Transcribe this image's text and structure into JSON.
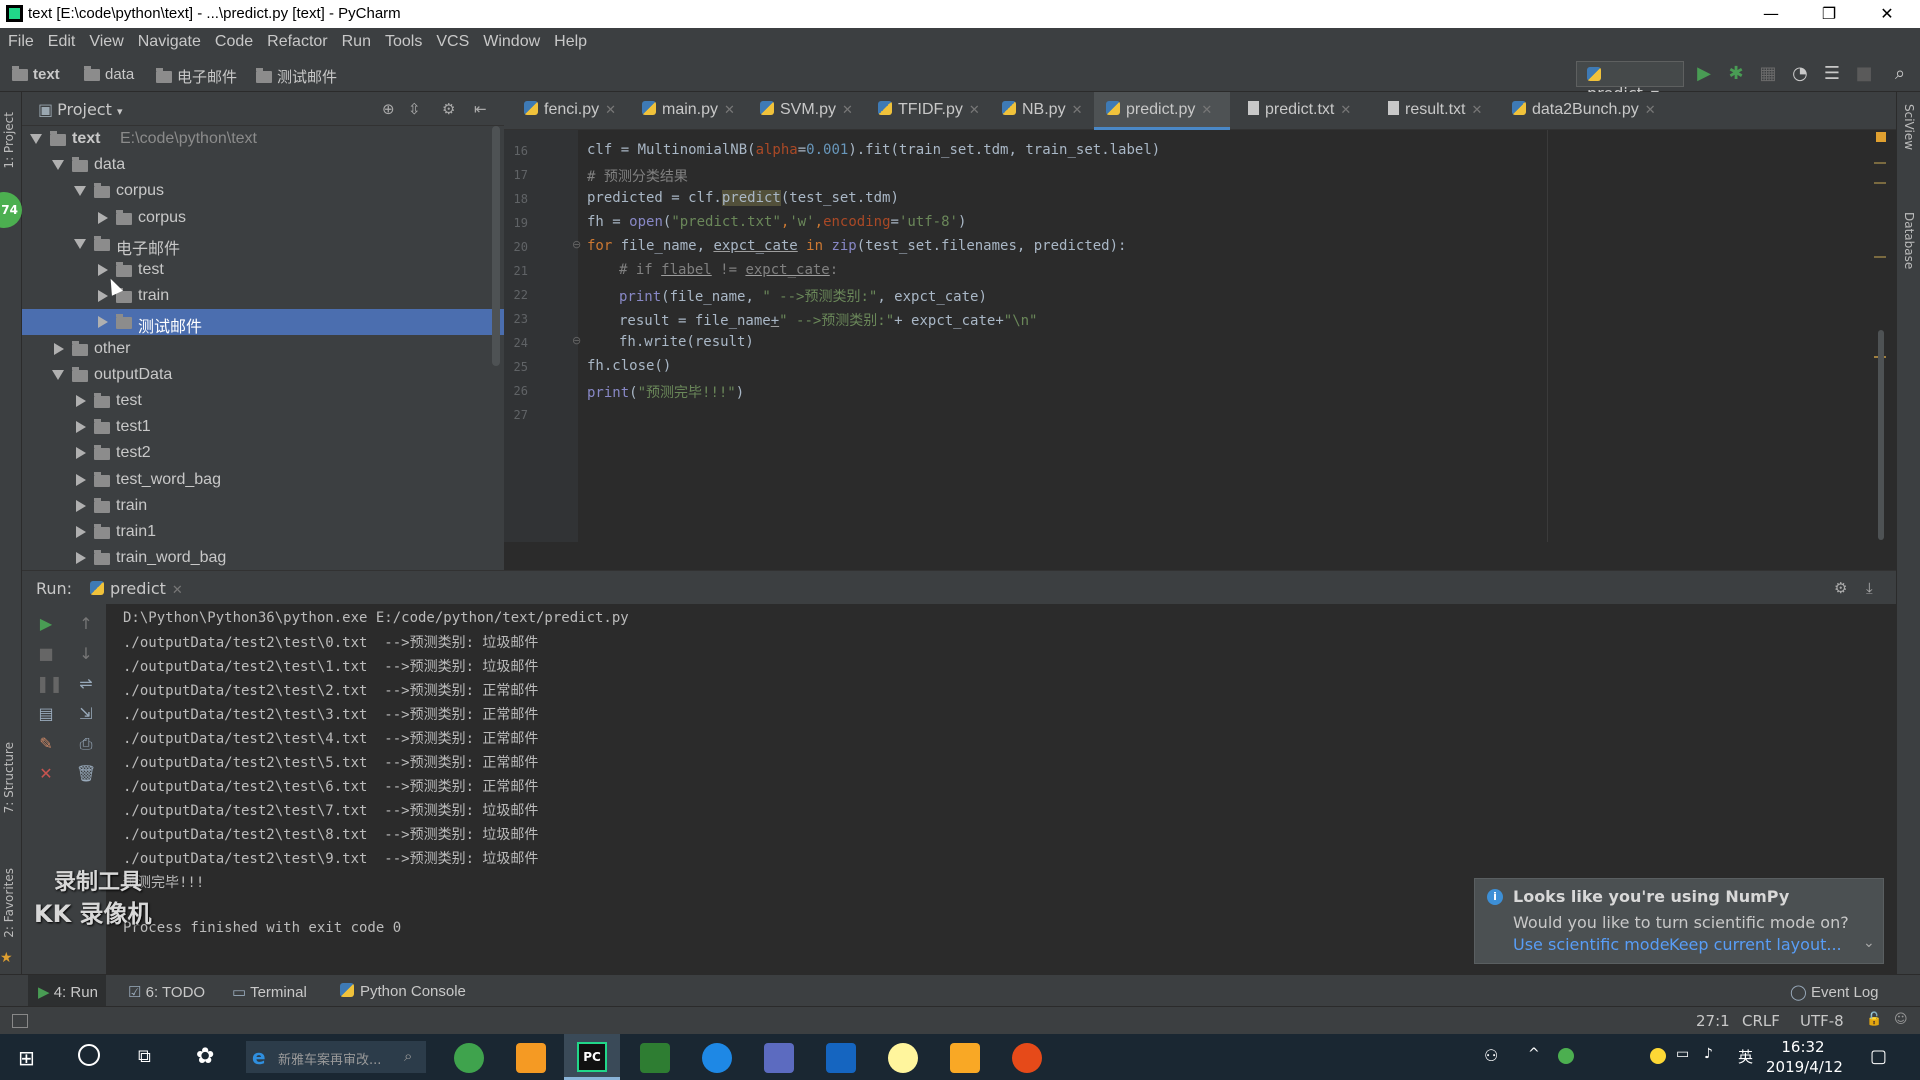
{
  "window": {
    "title": "text [E:\\code\\python\\text] - ...\\predict.py [text] - PyCharm",
    "minimize": "—",
    "restore": "❐",
    "close": "✕"
  },
  "menu": [
    "File",
    "Edit",
    "View",
    "Navigate",
    "Code",
    "Refactor",
    "Run",
    "Tools",
    "VCS",
    "Window",
    "Help"
  ],
  "breadcrumbs": [
    "text",
    "data",
    "电子邮件",
    "测试邮件"
  ],
  "run_config": {
    "label": "predict"
  },
  "project": {
    "title": "Project",
    "tree": [
      {
        "label": "text",
        "path": "E:\\code\\python\\text",
        "depth": 0,
        "state": "open",
        "bold": true
      },
      {
        "label": "data",
        "depth": 1,
        "state": "open"
      },
      {
        "label": "corpus",
        "depth": 2,
        "state": "open"
      },
      {
        "label": "corpus",
        "depth": 3,
        "state": "closed"
      },
      {
        "label": "电子邮件",
        "depth": 2,
        "state": "open"
      },
      {
        "label": "test",
        "depth": 3,
        "state": "closed"
      },
      {
        "label": "train",
        "depth": 3,
        "state": "closed"
      },
      {
        "label": "测试邮件",
        "depth": 3,
        "state": "closed",
        "selected": true
      },
      {
        "label": "other",
        "depth": 1,
        "state": "closed"
      },
      {
        "label": "outputData",
        "depth": 1,
        "state": "open"
      },
      {
        "label": "test",
        "depth": 2,
        "state": "closed"
      },
      {
        "label": "test1",
        "depth": 2,
        "state": "closed"
      },
      {
        "label": "test2",
        "depth": 2,
        "state": "closed"
      },
      {
        "label": "test_word_bag",
        "depth": 2,
        "state": "closed"
      },
      {
        "label": "train",
        "depth": 2,
        "state": "closed"
      },
      {
        "label": "train1",
        "depth": 2,
        "state": "closed"
      },
      {
        "label": "train_word_bag",
        "depth": 2,
        "state": "closed"
      }
    ]
  },
  "tabs": [
    {
      "label": "fenci.py",
      "type": "py"
    },
    {
      "label": "main.py",
      "type": "py"
    },
    {
      "label": "SVM.py",
      "type": "py"
    },
    {
      "label": "TFIDF.py",
      "type": "py"
    },
    {
      "label": "NB.py",
      "type": "py"
    },
    {
      "label": "predict.py",
      "type": "py",
      "active": true
    },
    {
      "label": "predict.txt",
      "type": "txt"
    },
    {
      "label": "result.txt",
      "type": "txt"
    },
    {
      "label": "data2Bunch.py",
      "type": "py"
    }
  ],
  "editor": {
    "line_numbers": [
      "16",
      "17",
      "18",
      "19",
      "20",
      "21",
      "22",
      "23",
      "24",
      "25",
      "26",
      "27"
    ],
    "lines": {
      "l16a": "clf = MultinomialNB(",
      "l16b": "alpha",
      "l16c": "=",
      "l16d": "0.001",
      "l16e": ").fit(train_set.tdm, train_set.label)",
      "l17": "# 预测分类结果",
      "l18a": "predicted = clf.",
      "l18b": "predict",
      "l18c": "(test_set.tdm)",
      "l19a": "fh = ",
      "l19b": "open",
      "l19c": "(",
      "l19d": "\"predict.txt\"",
      "l19e": ",",
      "l19f": "'w'",
      "l19g": ",",
      "l19h": "encoding",
      "l19i": "=",
      "l19j": "'utf-8'",
      "l19k": ")",
      "l20a": "for ",
      "l20b": "file_name, ",
      "l20c": "expct_cate",
      "l20d": " in ",
      "l20e": "zip",
      "l20f": "(test_set.filenames, predicted):",
      "l21a": "# if ",
      "l21b": "flabel",
      "l21c": " != ",
      "l21d": "expct_cate",
      "l21e": ":",
      "l22a": "print",
      "l22b": "(file_name, ",
      "l22c": "\" -->预测类别:\"",
      "l22d": ", expct_cate)",
      "l23a": "result = file_name",
      "l23b": "+",
      "l23c": "\" -->预测类别:\"",
      "l23d": "+",
      "l23e": " expct_cate+",
      "l23f": "\"\\n\"",
      "l24": "fh.write(result)",
      "l25": "fh.close()",
      "l26a": "print",
      "l26b": "(",
      "l26c": "\"预测完毕!!!\"",
      "l26d": ")"
    }
  },
  "run": {
    "label": "Run:",
    "config": "predict",
    "command": "D:\\Python\\Python36\\python.exe E:/code/python/text/predict.py",
    "results": [
      "./outputData/test2\\test\\0.txt  -->预测类别: 垃圾邮件",
      "./outputData/test2\\test\\1.txt  -->预测类别: 垃圾邮件",
      "./outputData/test2\\test\\2.txt  -->预测类别: 正常邮件",
      "./outputData/test2\\test\\3.txt  -->预测类别: 正常邮件",
      "./outputData/test2\\test\\4.txt  -->预测类别: 正常邮件",
      "./outputData/test2\\test\\5.txt  -->预测类别: 正常邮件",
      "./outputData/test2\\test\\6.txt  -->预测类别: 正常邮件",
      "./outputData/test2\\test\\7.txt  -->预测类别: 垃圾邮件",
      "./outputData/test2\\test\\8.txt  -->预测类别: 垃圾邮件",
      "./outputData/test2\\test\\9.txt  -->预测类别: 垃圾邮件"
    ],
    "done": "预测完毕!!!",
    "exit": "Process finished with exit code 0"
  },
  "notification": {
    "title": "Looks like you're using NumPy",
    "body": "Would you like to turn scientific mode on?",
    "action1": "Use scientific mode",
    "action2": "Keep current layout..."
  },
  "bottom_tabs": {
    "run": "4: Run",
    "todo": "6: TODO",
    "terminal": "Terminal",
    "console": "Python Console",
    "event_log": "Event Log"
  },
  "side_tabs": {
    "project": "1: Project",
    "structure": "7: Structure",
    "favorites": "2: Favorites",
    "sciview": "SciView",
    "database": "Database"
  },
  "status": {
    "position": "27:1",
    "line_sep": "CRLF",
    "encoding": "UTF-8"
  },
  "watermark": {
    "line1": "录制工具",
    "line2": "KK 录像机"
  },
  "taskbar": {
    "search_text": "新雅车案再审改...",
    "time": "16:32",
    "date": "2019/4/12",
    "ime": "英"
  },
  "badge": "74",
  "colors": {
    "accent": "#4a88c7",
    "selection": "#4b6eaf",
    "run_green": "#499c54",
    "stop_red": "#c75450"
  }
}
